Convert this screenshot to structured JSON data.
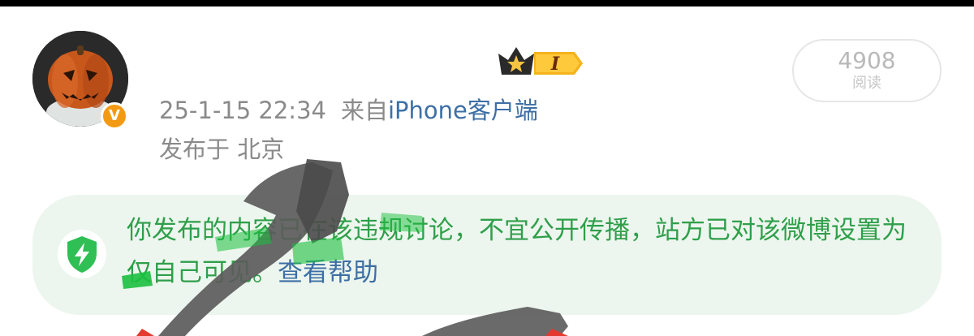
{
  "post": {
    "timestamp": "25-1-15 22:34",
    "source_prefix": "来自",
    "source_client": "iPhone客户端",
    "location_label": "发布于",
    "location": "北京",
    "read_count": "4908",
    "read_label": "阅读",
    "verified_symbol": "V",
    "crown_label": "I"
  },
  "notice": {
    "message": "你发布的内容已在该违规讨论，不宜公开传播，站方已对该微博设置为仅自己可见。",
    "help_link": "查看帮助"
  },
  "colors": {
    "notice_bg": "#edf6ee",
    "notice_text": "#2f9f4a",
    "link": "#3d6fa5",
    "meta_text": "#8a8a8a",
    "verified_badge": "#f39a14"
  }
}
